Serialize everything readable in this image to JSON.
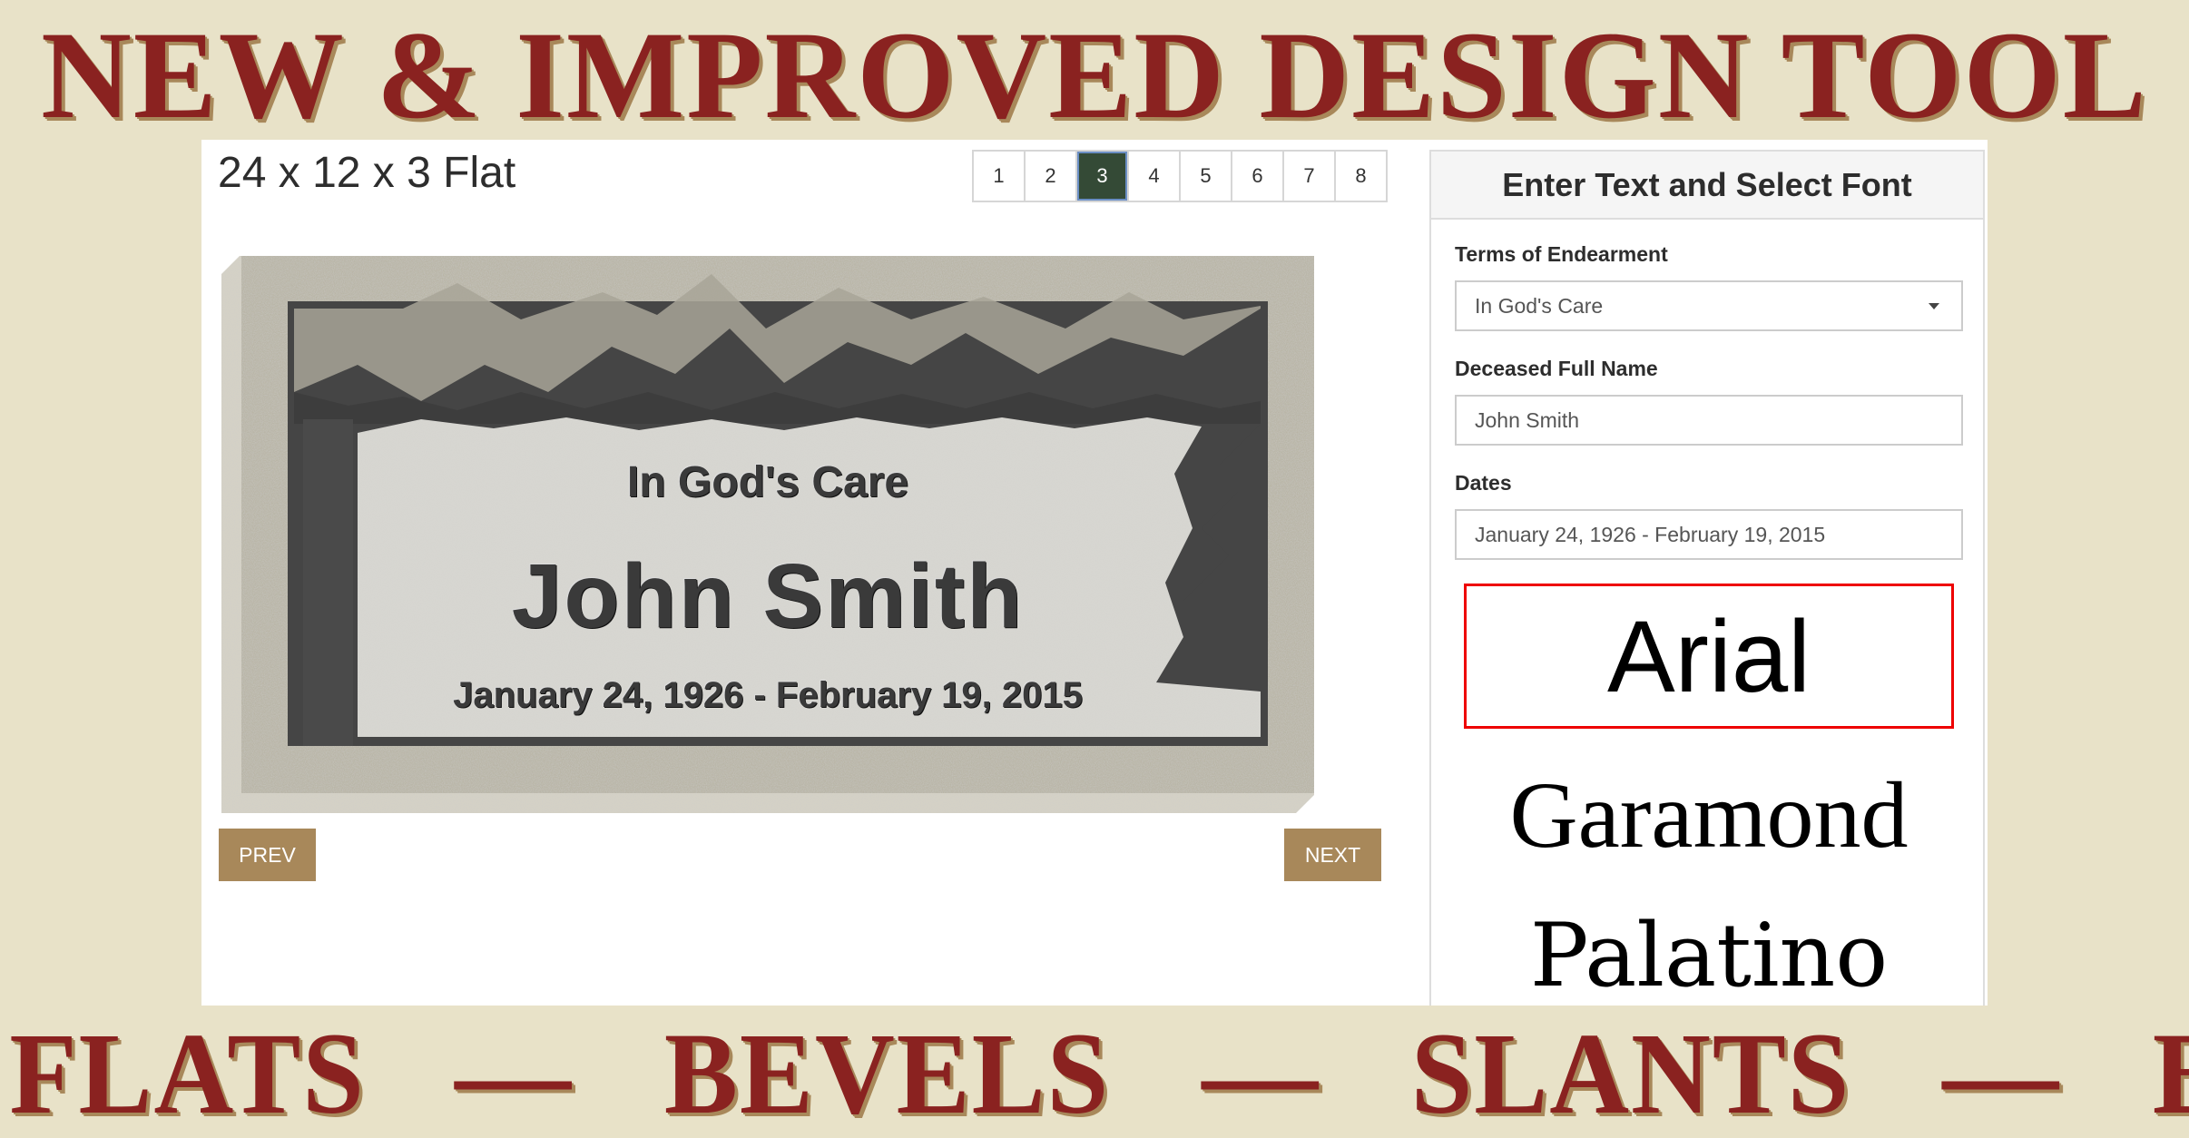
{
  "banner": {
    "title": "NEW & IMPROVED DESIGN TOOL",
    "categories": [
      "FLATS",
      "BEVELS",
      "SLANTS",
      "BRONZE"
    ],
    "separator": "—"
  },
  "product": {
    "title": "24 x 12 x 3 Flat"
  },
  "pagination": {
    "pages": [
      "1",
      "2",
      "3",
      "4",
      "5",
      "6",
      "7",
      "8"
    ],
    "active": "3"
  },
  "preview": {
    "term": "In God's Care",
    "name": "John Smith",
    "dates": "January 24, 1926 - February 19, 2015",
    "design": "mountain-forest-scene"
  },
  "nav": {
    "prev_label": "PREV",
    "next_label": "NEXT"
  },
  "form": {
    "header": "Enter Text and Select Font",
    "term_label": "Terms of Endearment",
    "term_value": "In God's Care",
    "name_label": "Deceased Full Name",
    "name_value": "John Smith",
    "dates_label": "Dates",
    "dates_value": "January 24, 1926 - February 19, 2015"
  },
  "fonts": {
    "options": [
      "Arial",
      "Garamond",
      "Palatino"
    ],
    "selected": "Arial"
  },
  "colors": {
    "banner_text": "#8a2220",
    "banner_shadow": "#a8885a",
    "background": "#e8e2c8",
    "active_page": "#344a36",
    "nav_button": "#a8885a",
    "selected_font_border": "#e00000"
  }
}
